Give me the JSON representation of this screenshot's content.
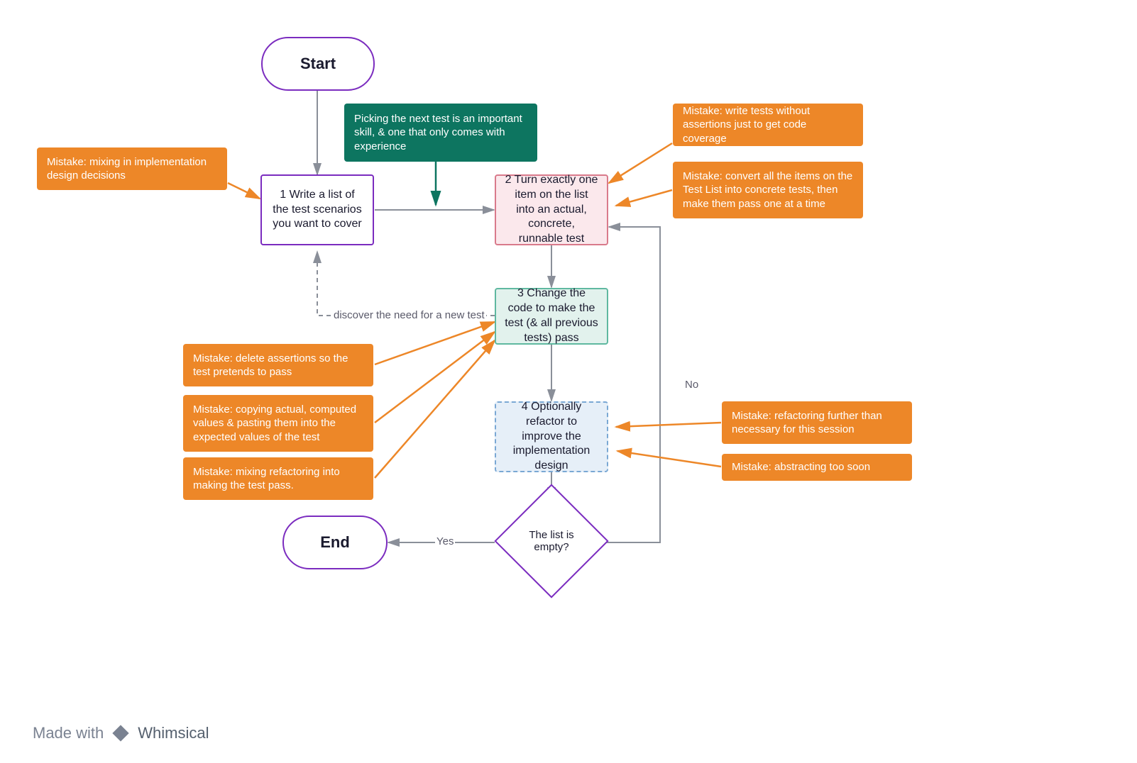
{
  "diagram": {
    "title_implicit": "TDD flow with common mistakes",
    "terminators": {
      "start": "Start",
      "end": "End"
    },
    "steps": {
      "s1": "1 Write a list of the test scenarios you want to cover",
      "s2": "2 Turn exactly one item on the list into an actual, concrete, runnable test",
      "s3": "3 Change the code to make the test (& all previous tests) pass",
      "s4": "4 Optionally refactor to improve the implementation design"
    },
    "decision": "The list is empty?",
    "edge_labels": {
      "discover": "discover the need for a new test",
      "no": "No",
      "yes": "Yes"
    },
    "tip": "Picking the next test is an important skill, & one that only comes with experience",
    "mistakes": {
      "m1": "Mistake: mixing in implementation design decisions",
      "m2": "Mistake: write tests without assertions just to get code coverage",
      "m3": "Mistake: convert all the items on the Test List into concrete tests, then make them pass one at a time",
      "m4": "Mistake: delete assertions so the test pretends to pass",
      "m5": "Mistake: copying actual, computed values & pasting them into the expected values of the test",
      "m6": "Mistake: mixing refactoring into making the test pass.",
      "m7": "Mistake: refactoring further than necessary for this session",
      "m8": "Mistake: abstracting too soon"
    }
  },
  "footer": {
    "made_with": "Made with",
    "brand": "Whimsical"
  },
  "colors": {
    "purple": "#7b2cbf",
    "orange": "#ed8728",
    "teal_dark": "#0d7560",
    "pink_border": "#d97a8b",
    "teal_border": "#5fb8a0",
    "blue_border": "#7aa8d4",
    "gray_arrow": "#8a8f99"
  }
}
